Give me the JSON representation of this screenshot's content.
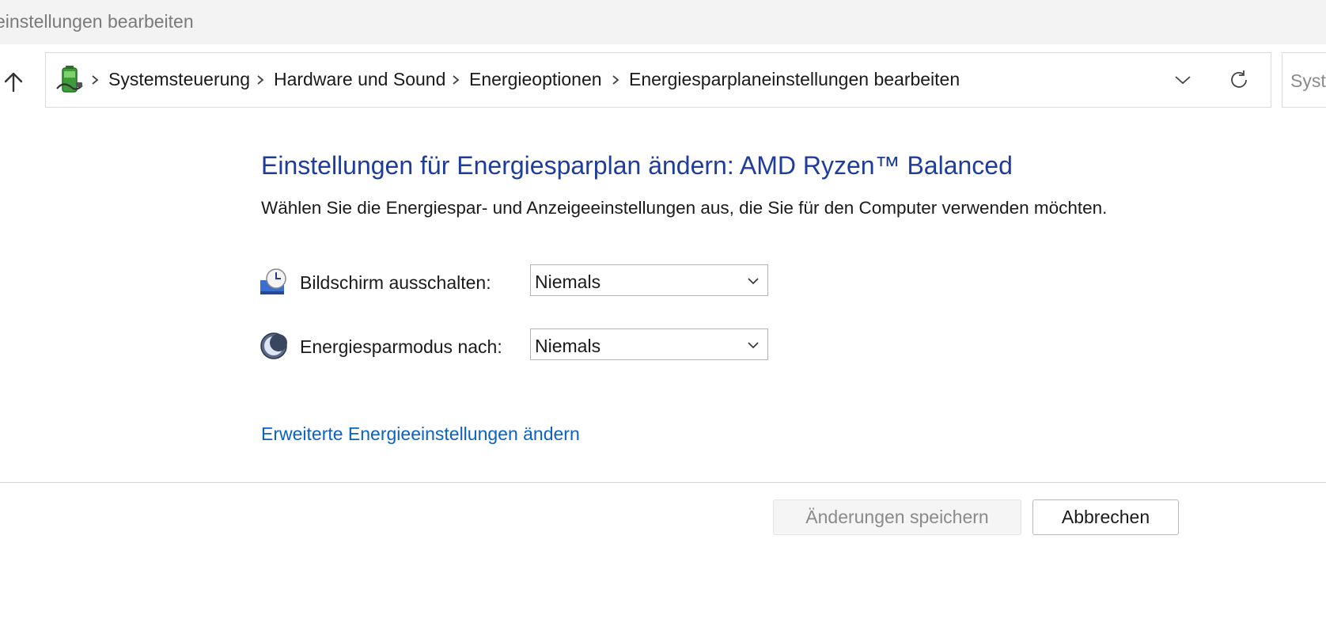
{
  "window": {
    "title": "einstellungen bearbeiten"
  },
  "address_bar": {
    "breadcrumbs": [
      "Systemsteuerung",
      "Hardware und Sound",
      "Energieoptionen",
      "Energiesparplaneinstellungen bearbeiten"
    ],
    "icons": {
      "up": "arrow-up-icon",
      "location": "power-battery-icon",
      "separator": "chevron-right-icon",
      "history": "chevron-down-icon",
      "refresh": "refresh-icon"
    }
  },
  "search": {
    "placeholder": "Systemsteuerung durchsuchen"
  },
  "main": {
    "title": "Einstellungen für Energiesparplan ändern: AMD Ryzen™ Balanced",
    "subtitle": "Wählen Sie die Energiespar- und Anzeigeeinstellungen aus, die Sie für den Computer verwenden möchten.",
    "settings": [
      {
        "label": "Bildschirm ausschalten:",
        "value": "Niemals",
        "icon": "monitor-clock-icon"
      },
      {
        "label": "Energiesparmodus nach:",
        "value": "Niemals",
        "icon": "moon-sleep-icon"
      }
    ],
    "advanced_link": "Erweiterte Energieeinstellungen ändern"
  },
  "footer": {
    "save_label": "Änderungen speichern",
    "cancel_label": "Abbrechen"
  },
  "colors": {
    "title": "#1e3c9c",
    "link": "#0a61c6",
    "disabled_text": "#8a8a8a"
  }
}
